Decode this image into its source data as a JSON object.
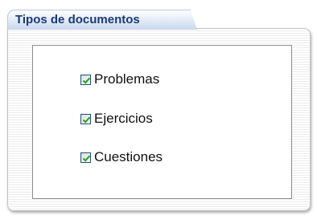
{
  "panel": {
    "title": "Tipos de documentos"
  },
  "options": [
    {
      "label": "Problemas",
      "checked": true
    },
    {
      "label": "Ejercicios",
      "checked": true
    },
    {
      "label": "Cuestiones",
      "checked": true
    }
  ],
  "colors": {
    "tab_text": "#1b3a76",
    "check_mark": "#21a121",
    "checkbox_border": "#1c5180"
  }
}
